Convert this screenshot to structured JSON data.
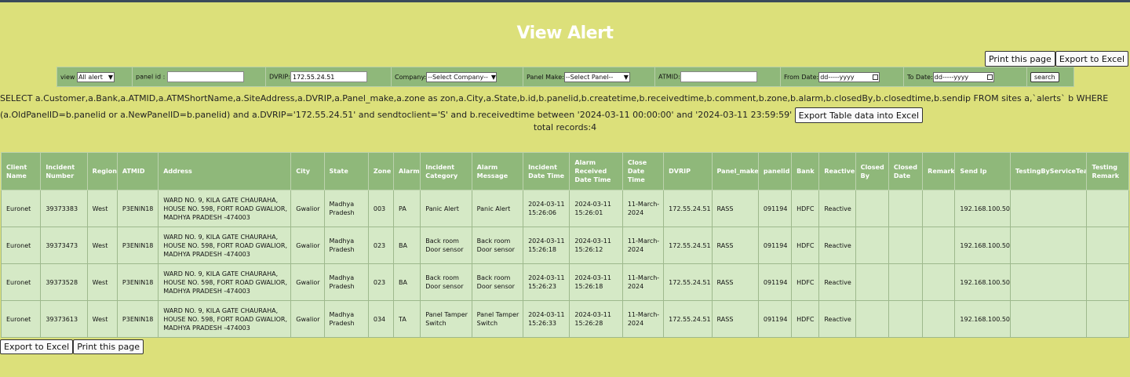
{
  "page": {
    "title": "View Alert"
  },
  "actions": {
    "print_label": "Print this page",
    "export_label": "Export to Excel",
    "export_table_label": "Export Table data into Excel"
  },
  "filters": {
    "view_label": "view",
    "view_value": "All alert",
    "panel_id_label": "panel id :",
    "panel_id_value": "",
    "dvrip_label": "DVRIP:",
    "dvrip_value": "172.55.24.51",
    "company_label": "Company:",
    "company_value": "--Select Company--",
    "panel_make_label": "Panel Make:",
    "panel_make_value": "--Select Panel--",
    "atmid_label": "ATMID:",
    "atmid_value": "",
    "from_date_label": "From Date:",
    "from_date_placeholder": "dd-----yyyy",
    "to_date_label": "To Date:",
    "to_date_placeholder": "dd-----yyyy",
    "search_label": "search"
  },
  "query_text": "SELECT a.Customer,a.Bank,a.ATMID,a.ATMShortName,a.SiteAddress,a.DVRIP,a.Panel_make,a.zone as zon,a.City,a.State,b.id,b.panelid,b.createtime,b.receivedtime,b.comment,b.zone,b.alarm,b.closedBy,b.closedtime,b.sendip FROM sites a,`alerts` b WHERE (a.OldPanelID=b.panelid or a.NewPanelID=b.panelid) and a.DVRIP='172.55.24.51' and sendtoclient='S' and b.receivedtime between '2024-03-11 00:00:00' and '2024-03-11 23:59:59'",
  "total_records": "total records:4",
  "table": {
    "headers": [
      "Client Name",
      "Incident Number",
      "Region",
      "ATMID",
      "Address",
      "City",
      "State",
      "Zone",
      "Alarm",
      "Incident Category",
      "Alarm Message",
      "Incident Date Time",
      "Alarm Received Date Time",
      "Close Date Time",
      "DVRIP",
      "Panel_make",
      "panelid",
      "Bank",
      "Reactive",
      "Closed By",
      "Closed Date",
      "Remark",
      "Send Ip",
      "TestingByServiceTeam",
      "Testing Remark"
    ],
    "rows": [
      [
        "Euronet",
        "39373383",
        "West",
        "P3ENIN18",
        "WARD NO. 9, KILA GATE CHAURAHA, HOUSE NO. 598, FORT ROAD GWALIOR, MADHYA PRADESH -474003",
        "Gwalior",
        "Madhya Pradesh",
        "003",
        "PA",
        "Panic Alert",
        "Panic Alert",
        "2024-03-11 15:26:06",
        "2024-03-11 15:26:01",
        "11-March-2024",
        "172.55.24.51",
        "RASS",
        "091194",
        "HDFC",
        "Reactive",
        "",
        "",
        "",
        "192.168.100.50",
        "",
        ""
      ],
      [
        "Euronet",
        "39373473",
        "West",
        "P3ENIN18",
        "WARD NO. 9, KILA GATE CHAURAHA, HOUSE NO. 598, FORT ROAD GWALIOR, MADHYA PRADESH -474003",
        "Gwalior",
        "Madhya Pradesh",
        "023",
        "BA",
        "Back room Door sensor",
        "Back room Door sensor",
        "2024-03-11 15:26:18",
        "2024-03-11 15:26:12",
        "11-March-2024",
        "172.55.24.51",
        "RASS",
        "091194",
        "HDFC",
        "Reactive",
        "",
        "",
        "",
        "192.168.100.50",
        "",
        ""
      ],
      [
        "Euronet",
        "39373528",
        "West",
        "P3ENIN18",
        "WARD NO. 9, KILA GATE CHAURAHA, HOUSE NO. 598, FORT ROAD GWALIOR, MADHYA PRADESH -474003",
        "Gwalior",
        "Madhya Pradesh",
        "023",
        "BA",
        "Back room Door sensor",
        "Back room Door sensor",
        "2024-03-11 15:26:23",
        "2024-03-11 15:26:18",
        "11-March-2024",
        "172.55.24.51",
        "RASS",
        "091194",
        "HDFC",
        "Reactive",
        "",
        "",
        "",
        "192.168.100.50",
        "",
        ""
      ],
      [
        "Euronet",
        "39373613",
        "West",
        "P3ENIN18",
        "WARD NO. 9, KILA GATE CHAURAHA, HOUSE NO. 598, FORT ROAD GWALIOR, MADHYA PRADESH -474003",
        "Gwalior",
        "Madhya Pradesh",
        "034",
        "TA",
        "Panel Tamper Switch",
        "Panel Tamper Switch",
        "2024-03-11 15:26:33",
        "2024-03-11 15:26:28",
        "11-March-2024",
        "172.55.24.51",
        "RASS",
        "091194",
        "HDFC",
        "Reactive",
        "",
        "",
        "",
        "192.168.100.50",
        "",
        ""
      ]
    ]
  }
}
